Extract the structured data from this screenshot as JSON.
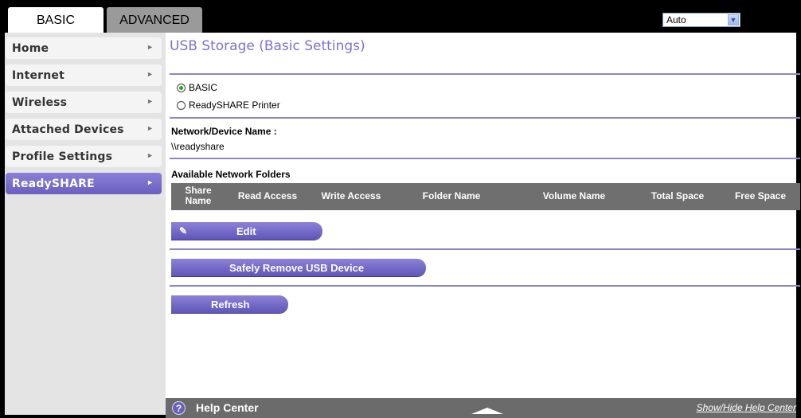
{
  "tabs": [
    {
      "label": "BASIC"
    },
    {
      "label": "ADVANCED"
    }
  ],
  "language_select": {
    "value": "Auto"
  },
  "sidebar": {
    "items": [
      {
        "label": "Home"
      },
      {
        "label": "Internet"
      },
      {
        "label": "Wireless"
      },
      {
        "label": "Attached Devices"
      },
      {
        "label": "Profile Settings"
      },
      {
        "label": "ReadySHARE",
        "active": true
      }
    ]
  },
  "page": {
    "title": "USB Storage (Basic Settings)",
    "radio_basic": "BASIC",
    "radio_printer": "ReadySHARE Printer",
    "network_device_label": "Network/Device Name :",
    "network_device_value": "\\\\readyshare",
    "folders_label": "Available Network Folders"
  },
  "table": {
    "headers": [
      "Share Name",
      "Read Access",
      "Write Access",
      "Folder Name",
      "Volume Name",
      "Total Space",
      "Free Space"
    ],
    "rows": []
  },
  "buttons": {
    "edit": "Edit",
    "safely_remove": "Safely Remove USB Device",
    "refresh": "Refresh"
  },
  "help": {
    "icon": "?",
    "title": "Help Center",
    "toggle": "Show/Hide Help Center"
  },
  "colors": {
    "accent": "#7d71cf",
    "button": "#6a5fc0",
    "header_gray": "#6f6f6f"
  }
}
